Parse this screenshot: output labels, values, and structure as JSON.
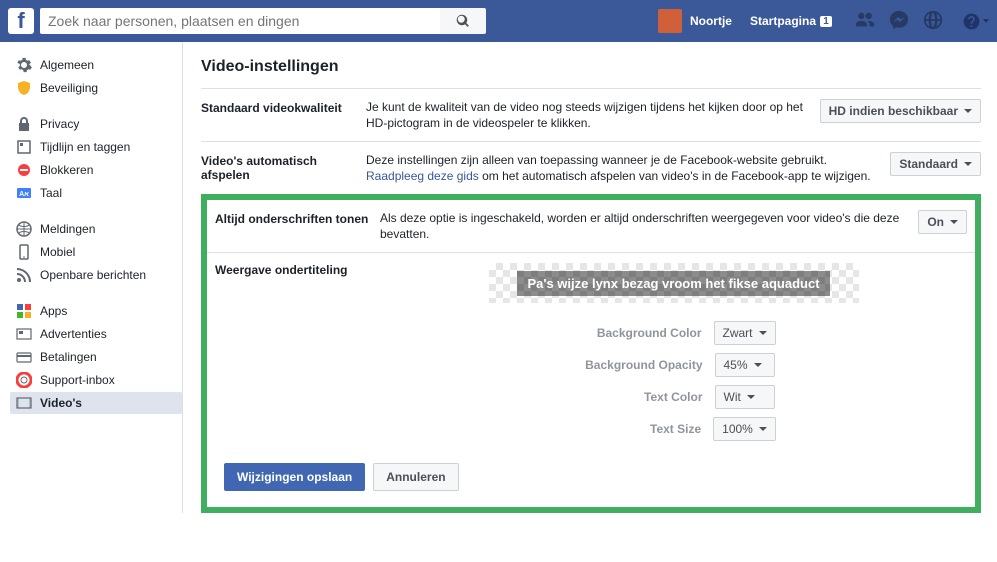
{
  "header": {
    "search_placeholder": "Zoek naar personen, plaatsen en dingen",
    "user_name": "Noortje",
    "home_label": "Startpagina",
    "home_badge": "1"
  },
  "sidebar": {
    "groups": [
      {
        "items": [
          {
            "label": "Algemeen",
            "name": "algemeen"
          },
          {
            "label": "Beveiliging",
            "name": "beveiliging"
          }
        ]
      },
      {
        "items": [
          {
            "label": "Privacy",
            "name": "privacy"
          },
          {
            "label": "Tijdlijn en taggen",
            "name": "tijdlijn"
          },
          {
            "label": "Blokkeren",
            "name": "blokkeren"
          },
          {
            "label": "Taal",
            "name": "taal"
          }
        ]
      },
      {
        "items": [
          {
            "label": "Meldingen",
            "name": "meldingen"
          },
          {
            "label": "Mobiel",
            "name": "mobiel"
          },
          {
            "label": "Openbare berichten",
            "name": "openbare"
          }
        ]
      },
      {
        "items": [
          {
            "label": "Apps",
            "name": "apps"
          },
          {
            "label": "Advertenties",
            "name": "advertenties"
          },
          {
            "label": "Betalingen",
            "name": "betalingen"
          },
          {
            "label": "Support-inbox",
            "name": "support"
          },
          {
            "label": "Video's",
            "name": "videos",
            "active": true
          }
        ]
      }
    ]
  },
  "main": {
    "title": "Video-instellingen",
    "rows": {
      "quality": {
        "label": "Standaard videokwaliteit",
        "desc": "Je kunt de kwaliteit van de video nog steeds wijzigen tijdens het kijken door op het HD-pictogram in de videospeler te klikken.",
        "value": "HD indien beschikbaar"
      },
      "autoplay": {
        "label": "Video's automatisch afspelen",
        "desc_pre": "Deze instellingen zijn alleen van toepassing wanneer je de Facebook-website gebruikt. ",
        "desc_link": "Raadpleeg deze gids",
        "desc_post": " om het automatisch afspelen van video's in de Facebook-app te wijzigen.",
        "value": "Standaard"
      },
      "captions_always": {
        "label": "Altijd onderschriften tonen",
        "desc": "Als deze optie is ingeschakeld, worden er altijd onderschriften weergegeven voor video's die deze bevatten.",
        "value": "On"
      },
      "subtitle_display": {
        "label": "Weergave ondertiteling",
        "preview_text": "Pa's wijze lynx bezag vroom het fikse aquaduct",
        "options": {
          "bg_color": {
            "label": "Background Color",
            "value": "Zwart"
          },
          "bg_opacity": {
            "label": "Background Opacity",
            "value": "45%"
          },
          "text_color": {
            "label": "Text Color",
            "value": "Wit"
          },
          "text_size": {
            "label": "Text Size",
            "value": "100%"
          }
        },
        "save_label": "Wijzigingen opslaan",
        "cancel_label": "Annuleren"
      }
    }
  }
}
